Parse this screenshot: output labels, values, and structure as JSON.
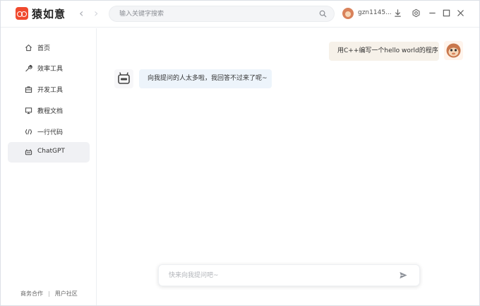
{
  "app": {
    "title": "猿如意"
  },
  "header": {
    "search_placeholder": "输入关键字搜索",
    "username": "gzn1145..."
  },
  "sidebar": {
    "items": [
      {
        "label": "首页",
        "icon": "home-icon",
        "active": false
      },
      {
        "label": "效率工具",
        "icon": "wrench-icon",
        "active": false
      },
      {
        "label": "开发工具",
        "icon": "toolbox-icon",
        "active": false
      },
      {
        "label": "教程文档",
        "icon": "monitor-icon",
        "active": false
      },
      {
        "label": "一行代码",
        "icon": "code-icon",
        "active": false
      },
      {
        "label": "ChatGPT",
        "icon": "robot-icon",
        "active": true
      }
    ],
    "footer": {
      "business": "商务合作",
      "separator": "|",
      "community": "用户社区"
    }
  },
  "chat": {
    "messages": [
      {
        "role": "user",
        "text": "用C++编写一个hello world的程序"
      },
      {
        "role": "bot",
        "text": "向我提问的人太多啦，我回答不过来了呢~"
      }
    ],
    "input_placeholder": "快来向我提问吧~"
  },
  "colors": {
    "brand": "#f04a2e",
    "user_bubble": "#f6f1e9",
    "bot_bubble": "#edf4fb",
    "active_item": "#f0f1f4"
  }
}
